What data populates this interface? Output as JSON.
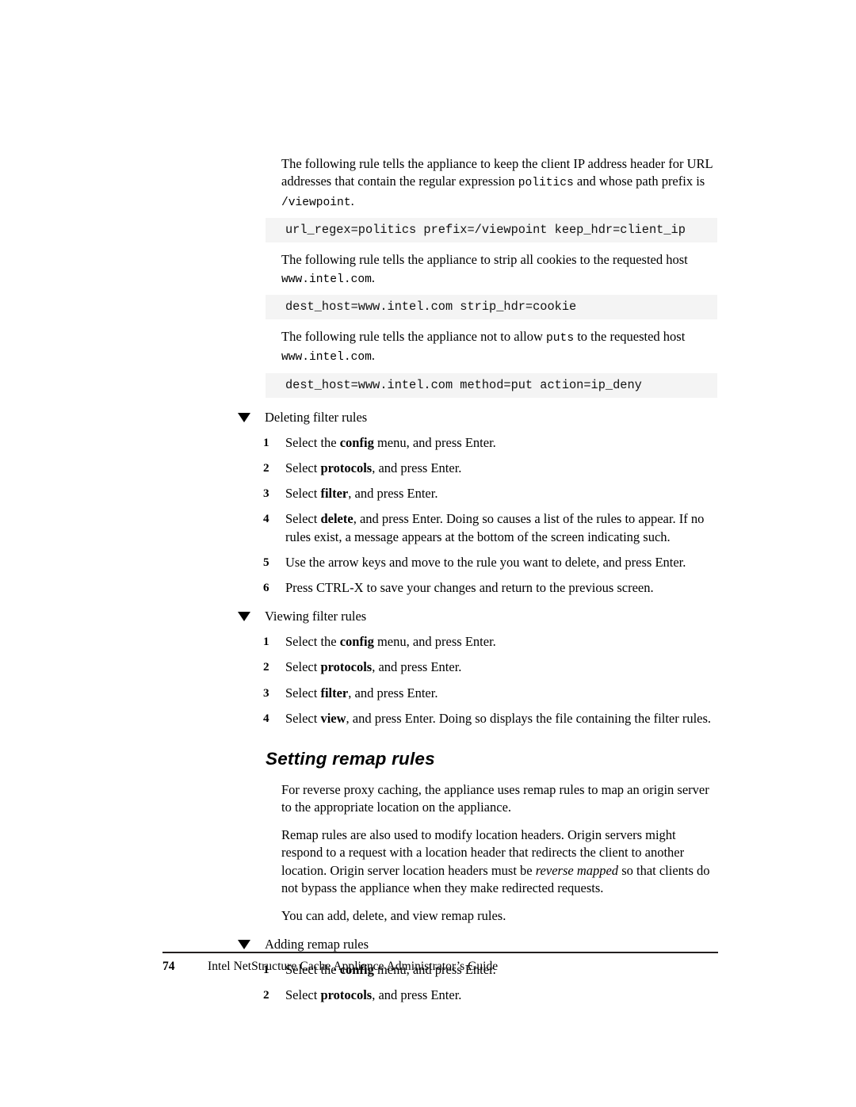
{
  "page": {
    "number": "74",
    "footer_text": "Intel NetStructure Cache Appliance Administrator’s Guide",
    "background_color": "#ffffff",
    "code_block_background": "#f4f4f4",
    "rule_color": "#231f20"
  },
  "paragraphs": {
    "p1_a": "The following rule tells the appliance to keep the client IP address header for URL addresses that contain the regular expression ",
    "p1_code1": "politics",
    "p1_b": " and whose path prefix is ",
    "p1_code2": "/viewpoint",
    "p1_c": ".",
    "code1": "url_regex=politics prefix=/viewpoint keep_hdr=client_ip",
    "p2_a": "The following rule tells the appliance to strip all cookies to the requested host ",
    "p2_code1": "www.intel.com",
    "p2_b": ".",
    "code2": "dest_host=www.intel.com strip_hdr=cookie",
    "p3_a": "The following rule tells the appliance not to allow ",
    "p3_code1": "puts",
    "p3_b": " to the requested host ",
    "p3_code2": "www.intel.com",
    "p3_c": ".",
    "code3": "dest_host=www.intel.com method=put action=ip_deny"
  },
  "procedures": [
    {
      "title": "Deleting filter rules",
      "steps": [
        {
          "num": "1",
          "pre": "Select the ",
          "bold": "config",
          "post": " menu, and press Enter."
        },
        {
          "num": "2",
          "pre": "Select ",
          "bold": "protocols",
          "post": ", and press Enter."
        },
        {
          "num": "3",
          "pre": "Select ",
          "bold": "filter",
          "post": ", and press Enter."
        },
        {
          "num": "4",
          "pre": "Select ",
          "bold": "delete",
          "post": ", and press Enter. Doing so causes a list of the rules to appear. If no rules exist, a message appears at the bottom of the screen indicating such."
        },
        {
          "num": "5",
          "pre": "Use the arrow keys and move to the rule you want to delete, and press Enter.",
          "bold": "",
          "post": ""
        },
        {
          "num": "6",
          "pre": "Press CTRL-X to save your changes and return to the previous screen.",
          "bold": "",
          "post": ""
        }
      ]
    },
    {
      "title": "Viewing filter rules",
      "steps": [
        {
          "num": "1",
          "pre": "Select the ",
          "bold": "config",
          "post": " menu, and press Enter."
        },
        {
          "num": "2",
          "pre": "Select ",
          "bold": "protocols",
          "post": ", and press Enter."
        },
        {
          "num": "3",
          "pre": "Select ",
          "bold": "filter",
          "post": ", and press Enter."
        },
        {
          "num": "4",
          "pre": "Select ",
          "bold": "view",
          "post": ", and press Enter. Doing so displays the file containing the filter rules."
        }
      ]
    },
    {
      "title": "Adding remap rules",
      "steps": [
        {
          "num": "1",
          "pre": "Select the ",
          "bold": "config",
          "post": " menu, and press Enter."
        },
        {
          "num": "2",
          "pre": "Select ",
          "bold": "protocols",
          "post": ", and press Enter."
        }
      ]
    }
  ],
  "section": {
    "heading": "Setting remap rules",
    "para1": "For reverse proxy caching, the appliance uses remap rules to map an origin server to the appropriate location on the appliance.",
    "para2_a": "Remap rules are also used to modify location headers. Origin servers might respond to a request with a location header that redirects the client to another location. Origin server location headers must be ",
    "para2_italic": "reverse mapped",
    "para2_b": " so that clients do not bypass the appliance when they make redirected requests.",
    "para3": "You can add, delete, and view remap rules."
  }
}
